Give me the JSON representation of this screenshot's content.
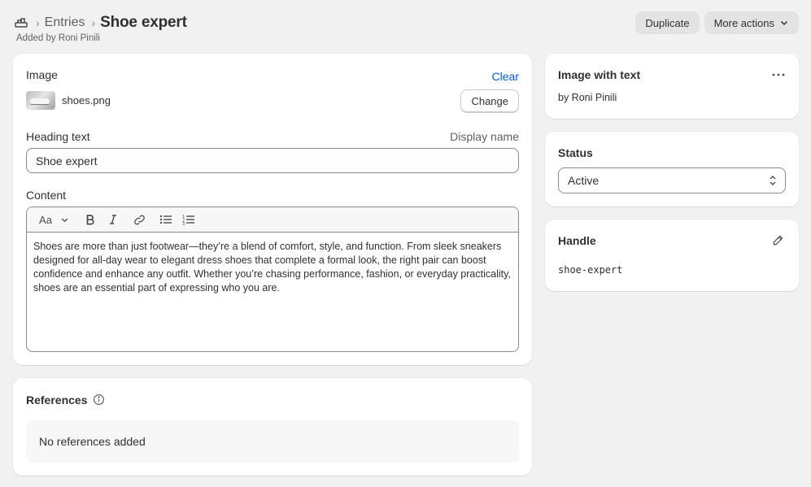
{
  "breadcrumb": {
    "icon": "metaobject-icon",
    "parent": "Entries",
    "title": "Shoe expert"
  },
  "header": {
    "subtitle": "Added by Roni Pinili",
    "duplicate_label": "Duplicate",
    "more_actions_label": "More actions"
  },
  "main": {
    "image_label": "Image",
    "clear_label": "Clear",
    "file_name": "shoes.png",
    "change_label": "Change",
    "heading_label": "Heading text",
    "display_name_label": "Display name",
    "heading_value": "Shoe expert",
    "content_label": "Content",
    "toolbar": {
      "font_label": "Aa"
    },
    "content_text": "Shoes are more than just footwear—they’re a blend of comfort, style, and function. From sleek sneakers designed for all-day wear to elegant dress shoes that complete a formal look, the right pair can boost confidence and enhance any outfit. Whether you’re chasing performance, fashion, or everyday practicality, shoes are an essential part of expressing who you are."
  },
  "references": {
    "title": "References",
    "empty_text": "No references added"
  },
  "definition_card": {
    "title": "Image with text",
    "author": "by Roni Pinili"
  },
  "status_card": {
    "title": "Status",
    "selected": "Active"
  },
  "handle_card": {
    "title": "Handle",
    "value": "shoe-expert"
  },
  "colors": {
    "background": "#f1f1f1",
    "link": "#005bd3",
    "text": "#303030",
    "muted": "#616161"
  }
}
